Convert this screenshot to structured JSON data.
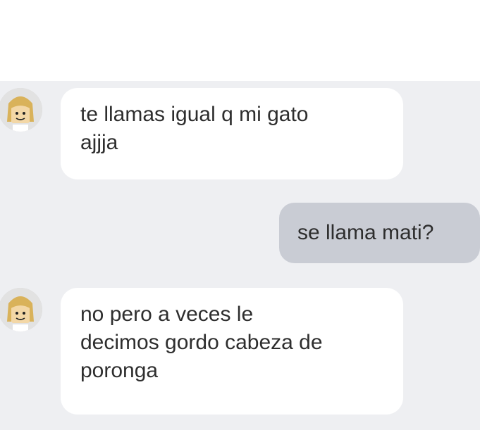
{
  "messages": [
    {
      "direction": "incoming",
      "sender_avatar": "blonde-avatar-icon",
      "lines": [
        "te llamas igual q mi gato",
        "ajjja"
      ]
    },
    {
      "direction": "outgoing",
      "lines": [
        "se llama mati?"
      ]
    },
    {
      "direction": "incoming",
      "sender_avatar": "blonde-avatar-icon",
      "lines": [
        "no pero a veces le",
        "decimos gordo cabeza de",
        "poronga"
      ]
    }
  ],
  "colors": {
    "chat_background": "#eeeff2",
    "incoming_bubble": "#ffffff",
    "outgoing_bubble": "#c9ccd4",
    "text": "#2e2e2e"
  }
}
